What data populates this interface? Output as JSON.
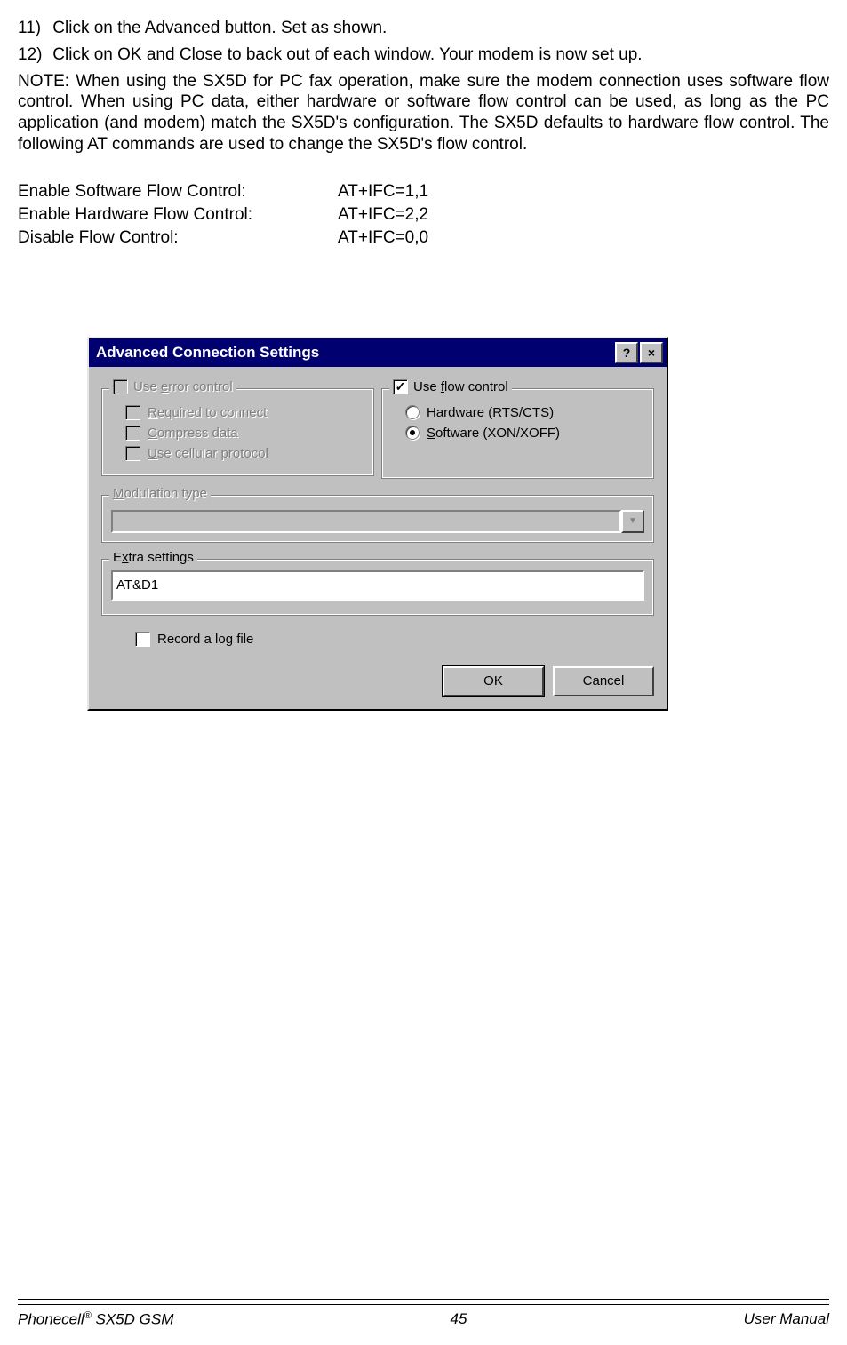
{
  "steps": {
    "s11_num": "11)",
    "s11_text": "Click on the Advanced button. Set as shown.",
    "s12_num": "12)",
    "s12_text": "Click on OK and Close to back out of each window. Your modem is now set up."
  },
  "note": "NOTE: When using the SX5D for PC fax operation, make sure the modem connection uses software flow control. When using PC data, either hardware or software flow control can be used, as long as the PC application (and modem) match the SX5D's configuration. The SX5D defaults to hardware flow control. The following AT commands are used to change the SX5D's flow control.",
  "cmds": {
    "r1_label": "Enable Software Flow Control:",
    "r1_val": "AT+IFC=1,1",
    "r2_label": "Enable Hardware Flow Control:",
    "r2_val": "AT+IFC=2,2",
    "r3_label": "Disable Flow Control:",
    "r3_val": "AT+IFC=0,0"
  },
  "dialog": {
    "title": "Advanced Connection Settings",
    "help_btn": "?",
    "close_btn": "×",
    "error_group": {
      "legend_pre": "Use ",
      "legend_ul": "e",
      "legend_post": "rror control",
      "opt1_ul": "R",
      "opt1_post": "equired to connect",
      "opt2_ul": "C",
      "opt2_post": "ompress data",
      "opt3_ul": "U",
      "opt3_post": "se cellular protocol"
    },
    "flow_group": {
      "legend_pre": "Use ",
      "legend_ul": "f",
      "legend_post": "low control",
      "opt1_ul": "H",
      "opt1_post": "ardware (RTS/CTS)",
      "opt2_ul": "S",
      "opt2_post": "oftware (XON/XOFF)"
    },
    "mod_group": {
      "legend_ul": "M",
      "legend_post": "odulation type"
    },
    "extra_group": {
      "legend_pre": "E",
      "legend_ul": "x",
      "legend_post": "tra settings",
      "value": "AT&D1"
    },
    "log_label": "Record a log file",
    "ok": "OK",
    "cancel": "Cancel"
  },
  "footer": {
    "left_pre": "Phonecell",
    "left_reg": "®",
    "left_post": " SX5D GSM",
    "center": "45",
    "right": "User Manual"
  }
}
